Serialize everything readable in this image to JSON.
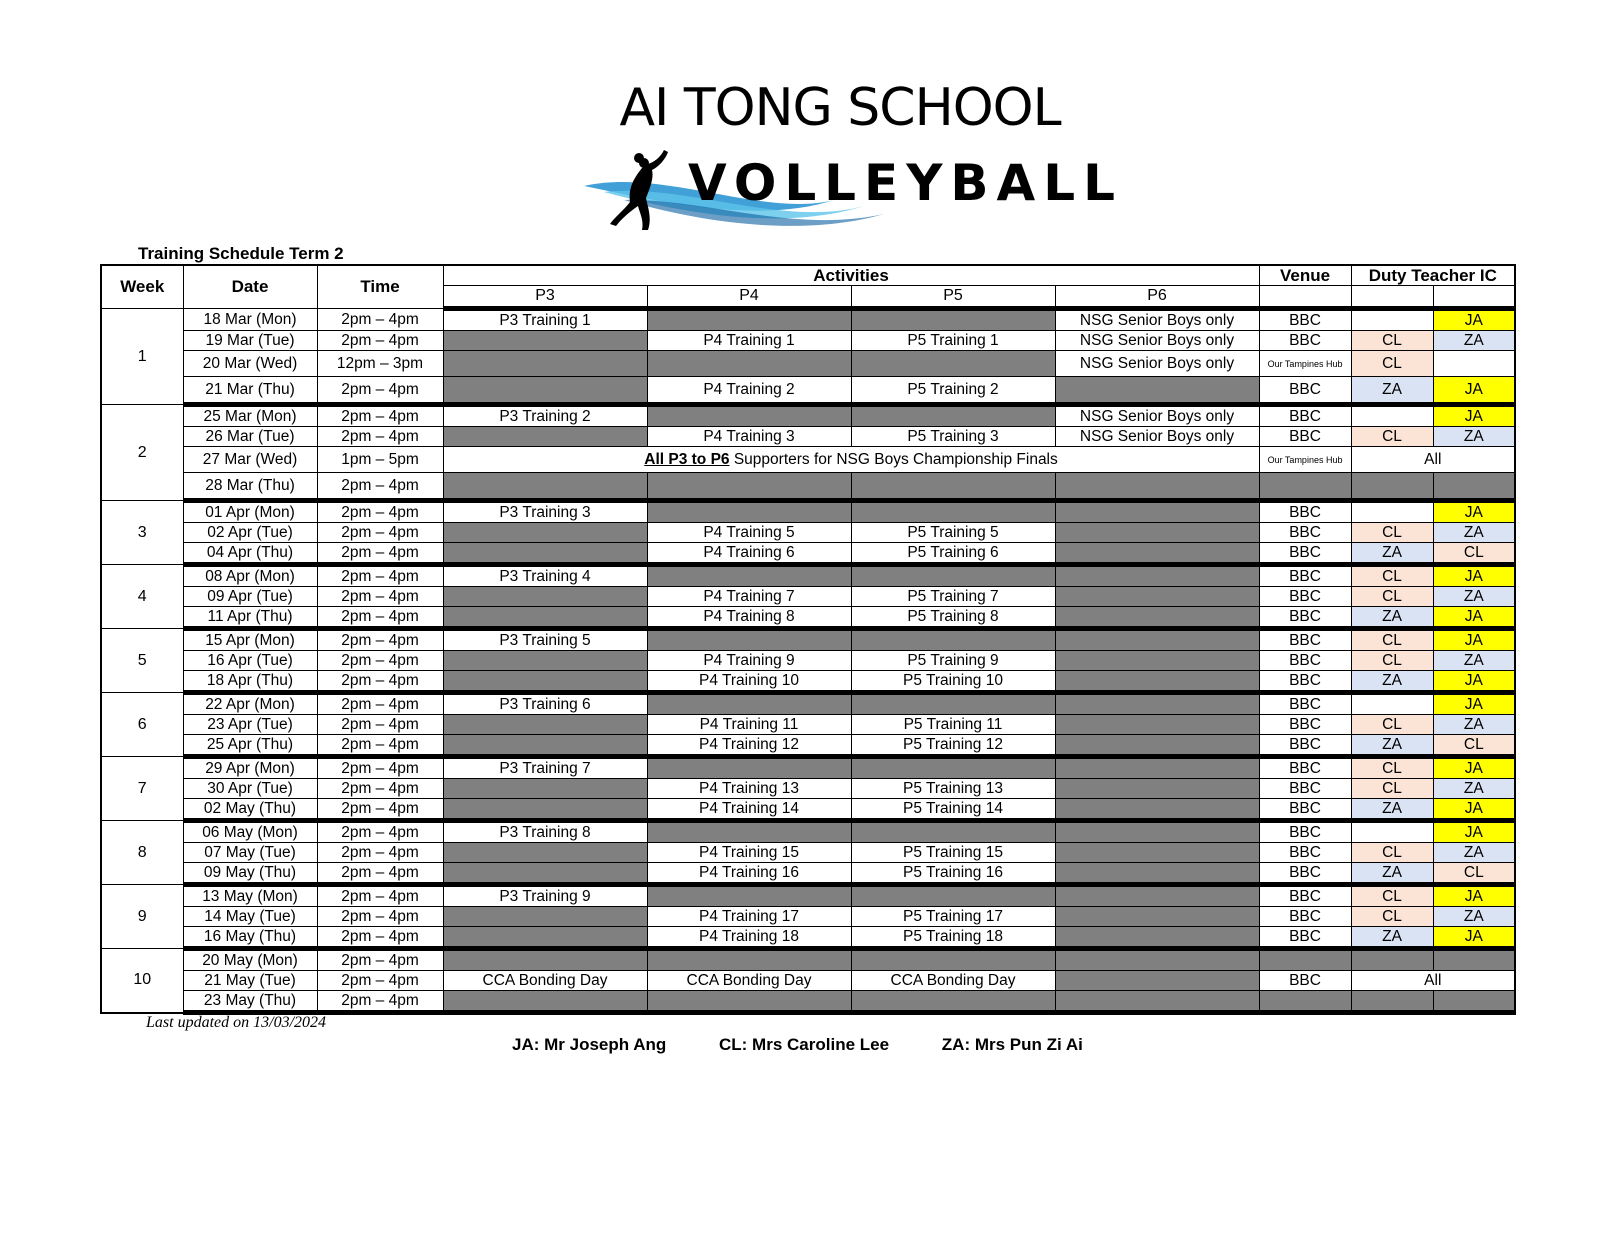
{
  "header": {
    "school": "AI TONG SCHOOL",
    "logo_text": "VOLLEYBALL",
    "schedule_title": "Training Schedule Term 2"
  },
  "columns": {
    "week": "Week",
    "date": "Date",
    "time": "Time",
    "activities": "Activities",
    "venue": "Venue",
    "duty": "Duty Teacher IC",
    "p3": "P3",
    "p4": "P4",
    "p5": "P5",
    "p6": "P6"
  },
  "special_row": {
    "bold_part": "All P3 to P6",
    "rest": " Supporters for NSG Boys Championship Finals"
  },
  "weeks": [
    {
      "week": "1",
      "rows": [
        {
          "date": "18 Mar (Mon)",
          "time": "2pm – 4pm",
          "p3": "P3 Training 1",
          "p4": null,
          "p5": null,
          "p6": "NSG Senior Boys only",
          "venue": "BBC",
          "d1": "",
          "d2": "JA"
        },
        {
          "date": "19 Mar (Tue)",
          "time": "2pm – 4pm",
          "p3": null,
          "p4": "P4 Training 1",
          "p5": "P5 Training 1",
          "p6": "NSG Senior Boys only",
          "venue": "BBC",
          "d1": "CL",
          "d2": "ZA"
        },
        {
          "date": "20 Mar (Wed)",
          "time": "12pm – 3pm",
          "p3": null,
          "p4": null,
          "p5": null,
          "p6": "NSG Senior Boys only",
          "venue": "Our Tampines Hub",
          "d1": "CL",
          "d2": ""
        },
        {
          "date": "21 Mar (Thu)",
          "time": "2pm – 4pm",
          "p3": null,
          "p4": "P4 Training 2",
          "p5": "P5 Training 2",
          "p6": null,
          "venue": "BBC",
          "d1": "ZA",
          "d2": "JA"
        }
      ]
    },
    {
      "week": "2",
      "rows": [
        {
          "date": "25 Mar (Mon)",
          "time": "2pm – 4pm",
          "p3": "P3 Training 2",
          "p4": null,
          "p5": null,
          "p6": "NSG Senior Boys only",
          "venue": "BBC",
          "d1": "",
          "d2": "JA"
        },
        {
          "date": "26 Mar (Tue)",
          "time": "2pm – 4pm",
          "p3": null,
          "p4": "P4 Training 3",
          "p5": "P5 Training 3",
          "p6": "NSG Senior Boys only",
          "venue": "BBC",
          "d1": "CL",
          "d2": "ZA"
        },
        {
          "date": "27 Mar (Wed)",
          "time": "1pm – 5pm",
          "special": true,
          "venue": "Our Tampines Hub",
          "duty_all": "All"
        },
        {
          "date": "28 Mar (Thu)",
          "time": "2pm – 4pm",
          "p3": null,
          "p4": null,
          "p5": null,
          "p6": null,
          "venue": null,
          "d1": null,
          "d2": null
        }
      ]
    },
    {
      "week": "3",
      "rows": [
        {
          "date": "01 Apr (Mon)",
          "time": "2pm – 4pm",
          "p3": "P3 Training 3",
          "p4": null,
          "p5": null,
          "p6": null,
          "venue": "BBC",
          "d1": "",
          "d2": "JA"
        },
        {
          "date": "02 Apr (Tue)",
          "time": "2pm – 4pm",
          "p3": null,
          "p4": "P4 Training 5",
          "p5": "P5 Training 5",
          "p6": null,
          "venue": "BBC",
          "d1": "CL",
          "d2": "ZA"
        },
        {
          "date": "04 Apr (Thu)",
          "time": "2pm – 4pm",
          "p3": null,
          "p4": "P4 Training 6",
          "p5": "P5 Training 6",
          "p6": null,
          "venue": "BBC",
          "d1": "ZA",
          "d2": "CL"
        }
      ]
    },
    {
      "week": "4",
      "rows": [
        {
          "date": "08 Apr (Mon)",
          "time": "2pm – 4pm",
          "p3": "P3 Training 4",
          "p4": null,
          "p5": null,
          "p6": null,
          "venue": "BBC",
          "d1": "CL",
          "d2": "JA"
        },
        {
          "date": "09 Apr (Tue)",
          "time": "2pm – 4pm",
          "p3": null,
          "p4": "P4 Training 7",
          "p5": "P5 Training 7",
          "p6": null,
          "venue": "BBC",
          "d1": "CL",
          "d2": "ZA"
        },
        {
          "date": "11 Apr (Thu)",
          "time": "2pm – 4pm",
          "p3": null,
          "p4": "P4 Training 8",
          "p5": "P5 Training 8",
          "p6": null,
          "venue": "BBC",
          "d1": "ZA",
          "d2": "JA"
        }
      ]
    },
    {
      "week": "5",
      "rows": [
        {
          "date": "15 Apr (Mon)",
          "time": "2pm – 4pm",
          "p3": "P3 Training 5",
          "p4": null,
          "p5": null,
          "p6": null,
          "venue": "BBC",
          "d1": "CL",
          "d2": "JA"
        },
        {
          "date": "16 Apr (Tue)",
          "time": "2pm – 4pm",
          "p3": null,
          "p4": "P4 Training 9",
          "p5": "P5 Training 9",
          "p6": null,
          "venue": "BBC",
          "d1": "CL",
          "d2": "ZA"
        },
        {
          "date": "18 Apr (Thu)",
          "time": "2pm – 4pm",
          "p3": null,
          "p4": "P4 Training 10",
          "p5": "P5 Training 10",
          "p6": null,
          "venue": "BBC",
          "d1": "ZA",
          "d2": "JA"
        }
      ]
    },
    {
      "week": "6",
      "rows": [
        {
          "date": "22 Apr (Mon)",
          "time": "2pm – 4pm",
          "p3": "P3 Training 6",
          "p4": null,
          "p5": null,
          "p6": null,
          "venue": "BBC",
          "d1": "",
          "d2": "JA"
        },
        {
          "date": "23 Apr (Tue)",
          "time": "2pm – 4pm",
          "p3": null,
          "p4": "P4 Training 11",
          "p5": "P5 Training 11",
          "p6": null,
          "venue": "BBC",
          "d1": "CL",
          "d2": "ZA"
        },
        {
          "date": "25 Apr (Thu)",
          "time": "2pm – 4pm",
          "p3": null,
          "p4": "P4 Training 12",
          "p5": "P5 Training 12",
          "p6": null,
          "venue": "BBC",
          "d1": "ZA",
          "d2": "CL"
        }
      ]
    },
    {
      "week": "7",
      "rows": [
        {
          "date": "29 Apr (Mon)",
          "time": "2pm – 4pm",
          "p3": "P3 Training 7",
          "p4": null,
          "p5": null,
          "p6": null,
          "venue": "BBC",
          "d1": "CL",
          "d2": "JA"
        },
        {
          "date": "30 Apr (Tue)",
          "time": "2pm – 4pm",
          "p3": null,
          "p4": "P4 Training 13",
          "p5": "P5 Training 13",
          "p6": null,
          "venue": "BBC",
          "d1": "CL",
          "d2": "ZA"
        },
        {
          "date": "02 May (Thu)",
          "time": "2pm – 4pm",
          "p3": null,
          "p4": "P4 Training 14",
          "p5": "P5 Training 14",
          "p6": null,
          "venue": "BBC",
          "d1": "ZA",
          "d2": "JA"
        }
      ]
    },
    {
      "week": "8",
      "rows": [
        {
          "date": "06 May (Mon)",
          "time": "2pm – 4pm",
          "p3": "P3 Training 8",
          "p4": null,
          "p5": null,
          "p6": null,
          "venue": "BBC",
          "d1": "",
          "d2": "JA"
        },
        {
          "date": "07 May (Tue)",
          "time": "2pm – 4pm",
          "p3": null,
          "p4": "P4 Training 15",
          "p5": "P5 Training 15",
          "p6": null,
          "venue": "BBC",
          "d1": "CL",
          "d2": "ZA"
        },
        {
          "date": "09 May (Thu)",
          "time": "2pm – 4pm",
          "p3": null,
          "p4": "P4 Training 16",
          "p5": "P5 Training 16",
          "p6": null,
          "venue": "BBC",
          "d1": "ZA",
          "d2": "CL"
        }
      ]
    },
    {
      "week": "9",
      "rows": [
        {
          "date": "13 May (Mon)",
          "time": "2pm – 4pm",
          "p3": "P3 Training 9",
          "p4": null,
          "p5": null,
          "p6": null,
          "venue": "BBC",
          "d1": "CL",
          "d2": "JA"
        },
        {
          "date": "14 May (Tue)",
          "time": "2pm – 4pm",
          "p3": null,
          "p4": "P4 Training 17",
          "p5": "P5 Training 17",
          "p6": null,
          "venue": "BBC",
          "d1": "CL",
          "d2": "ZA"
        },
        {
          "date": "16 May (Thu)",
          "time": "2pm – 4pm",
          "p3": null,
          "p4": "P4 Training 18",
          "p5": "P5 Training 18",
          "p6": null,
          "venue": "BBC",
          "d1": "ZA",
          "d2": "JA"
        }
      ]
    },
    {
      "week": "10",
      "rows": [
        {
          "date": "20 May (Mon)",
          "time": "2pm – 4pm",
          "p3": null,
          "p4": null,
          "p5": null,
          "p6": null,
          "venue": null,
          "d1": null,
          "d2": null
        },
        {
          "date": "21 May (Tue)",
          "time": "2pm – 4pm",
          "p3": "CCA Bonding Day",
          "p4": "CCA Bonding Day",
          "p5": "CCA Bonding Day",
          "p6": null,
          "venue": "BBC",
          "duty_all": "All"
        },
        {
          "date": "23 May (Thu)",
          "time": "2pm – 4pm",
          "p3": null,
          "p4": null,
          "p5": null,
          "p6": null,
          "venue": null,
          "d1": null,
          "d2": null
        }
      ]
    }
  ],
  "footer": {
    "updated": "Last updated on 13/03/2024",
    "legend": [
      "JA: Mr Joseph Ang",
      "CL: Mrs Caroline Lee",
      "ZA: Mrs Pun Zi Ai"
    ]
  },
  "colors": {
    "JA": "#ffff00",
    "CL": "#fbe4d5",
    "ZA": "#dae3f3",
    "blocked": "#808080"
  }
}
